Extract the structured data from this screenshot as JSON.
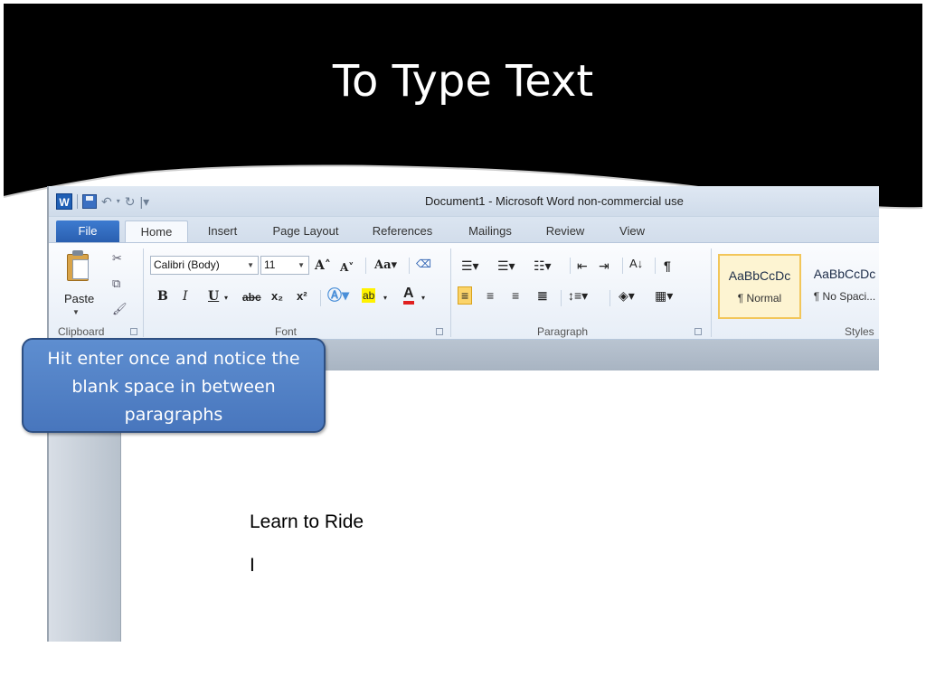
{
  "slide": {
    "title": "To Type Text",
    "callout": "Hit enter once and notice the blank space in between paragraphs"
  },
  "word": {
    "window_title": "Document1  -  Microsoft Word non-commercial use",
    "logo_letter": "W",
    "tabs": [
      {
        "label": "File"
      },
      {
        "label": "Home",
        "active": true
      },
      {
        "label": "Insert"
      },
      {
        "label": "Page Layout"
      },
      {
        "label": "References"
      },
      {
        "label": "Mailings"
      },
      {
        "label": "Review"
      },
      {
        "label": "View"
      }
    ],
    "ribbon": {
      "clipboard": {
        "label": "Clipboard",
        "paste_label": "Paste"
      },
      "font": {
        "label": "Font",
        "font_name": "Calibri (Body)",
        "font_size": "11"
      },
      "paragraph": {
        "label": "Paragraph"
      },
      "styles": {
        "label": "Styles",
        "items": [
          {
            "sample": "AaBbCcDc",
            "name": "¶ Normal"
          },
          {
            "sample": "AaBbCcDc",
            "name": "¶ No Spaci..."
          }
        ]
      }
    },
    "document": {
      "line1": "Learn to Ride",
      "cursor": "I"
    }
  },
  "colors": {
    "slide_header": "#000000",
    "callout_fill": "#4f81bd",
    "file_tab": "#2b5fb4"
  }
}
